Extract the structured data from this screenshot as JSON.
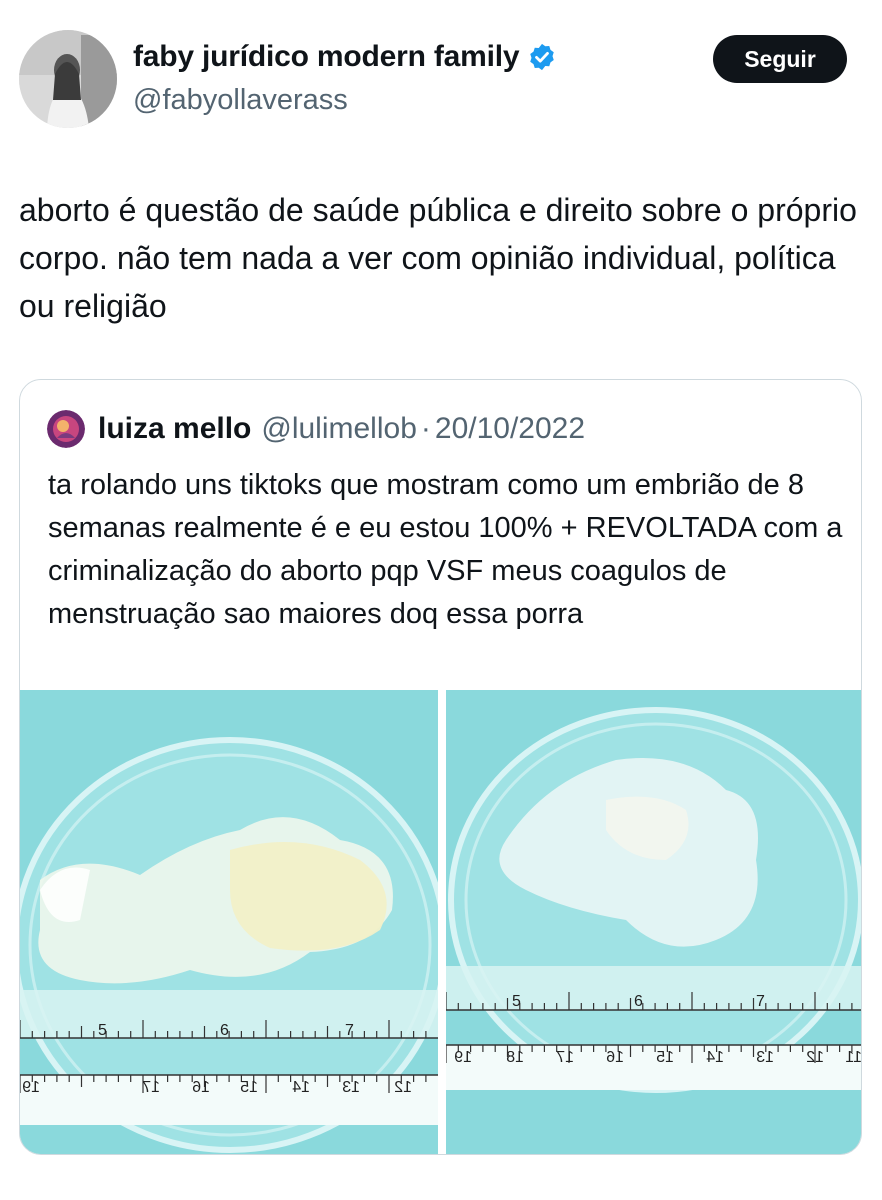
{
  "author": {
    "display_name": "faby jurídico modern family",
    "handle": "@fabyollaverass",
    "verified_icon": "verified-badge-icon",
    "verified_color": "#1d9bf0"
  },
  "follow_button": {
    "label": "Seguir"
  },
  "tweet": {
    "text": "aborto é questão de saúde pública e direito sobre o próprio corpo. não tem nada a ver com opinião individual, política ou religião"
  },
  "quoted": {
    "display_name": "luiza mello",
    "handle": "@lulimellob",
    "separator": "·",
    "date": "20/10/2022",
    "text": "ta rolando uns tiktoks que mostram como um embrião de 8 semanas realmente é e eu estou 100% + REVOLTADA com a criminalização do aborto pqp VSF meus coagulos de menstruação sao maiores doq essa porra",
    "media": [
      {
        "ruler_upper": [
          "5",
          "6",
          "7"
        ],
        "ruler_lower": [
          "19",
          "17",
          "16",
          "15",
          "14",
          "13",
          "12"
        ]
      },
      {
        "ruler_upper": [
          "5",
          "6",
          "7"
        ],
        "ruler_lower": [
          "19",
          "18",
          "17",
          "16",
          "15",
          "14",
          "13",
          "12",
          "11"
        ]
      }
    ]
  },
  "colors": {
    "text": "#0f1419",
    "secondary": "#536471",
    "border": "#cfd9de",
    "button_bg": "#0f1419",
    "media_bg": "#8ad9dc"
  }
}
